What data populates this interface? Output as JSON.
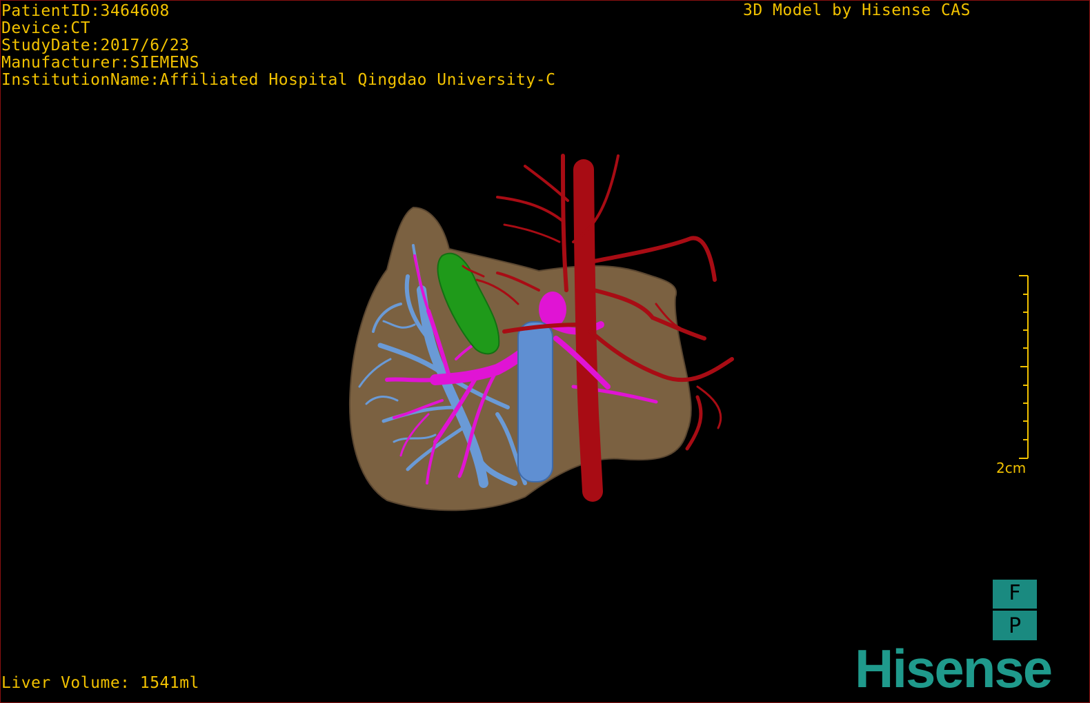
{
  "overlay": {
    "patient_id": "PatientID:3464608",
    "device": "Device:CT",
    "study_date": "StudyDate:2017/6/23",
    "manufacturer": "Manufacturer:SIEMENS",
    "institution": "InstitutionName:Affiliated Hospital Qingdao University-C",
    "model_credit": "3D Model by Hisense CAS",
    "liver_volume": "Liver Volume: 1541ml"
  },
  "scale_bar": {
    "label": "2cm"
  },
  "orientation": {
    "top": "F",
    "bottom": "P"
  },
  "brand": {
    "logo_text": "Hisense"
  },
  "colors": {
    "overlay_text": "#f2c200",
    "liver": "#7b6141",
    "artery": "#a80c14",
    "portal_vein": "#e014d4",
    "hepatic_vein": "#6a9ad6",
    "tumor": "#1f9a1a",
    "brand": "#1f9a8c"
  }
}
